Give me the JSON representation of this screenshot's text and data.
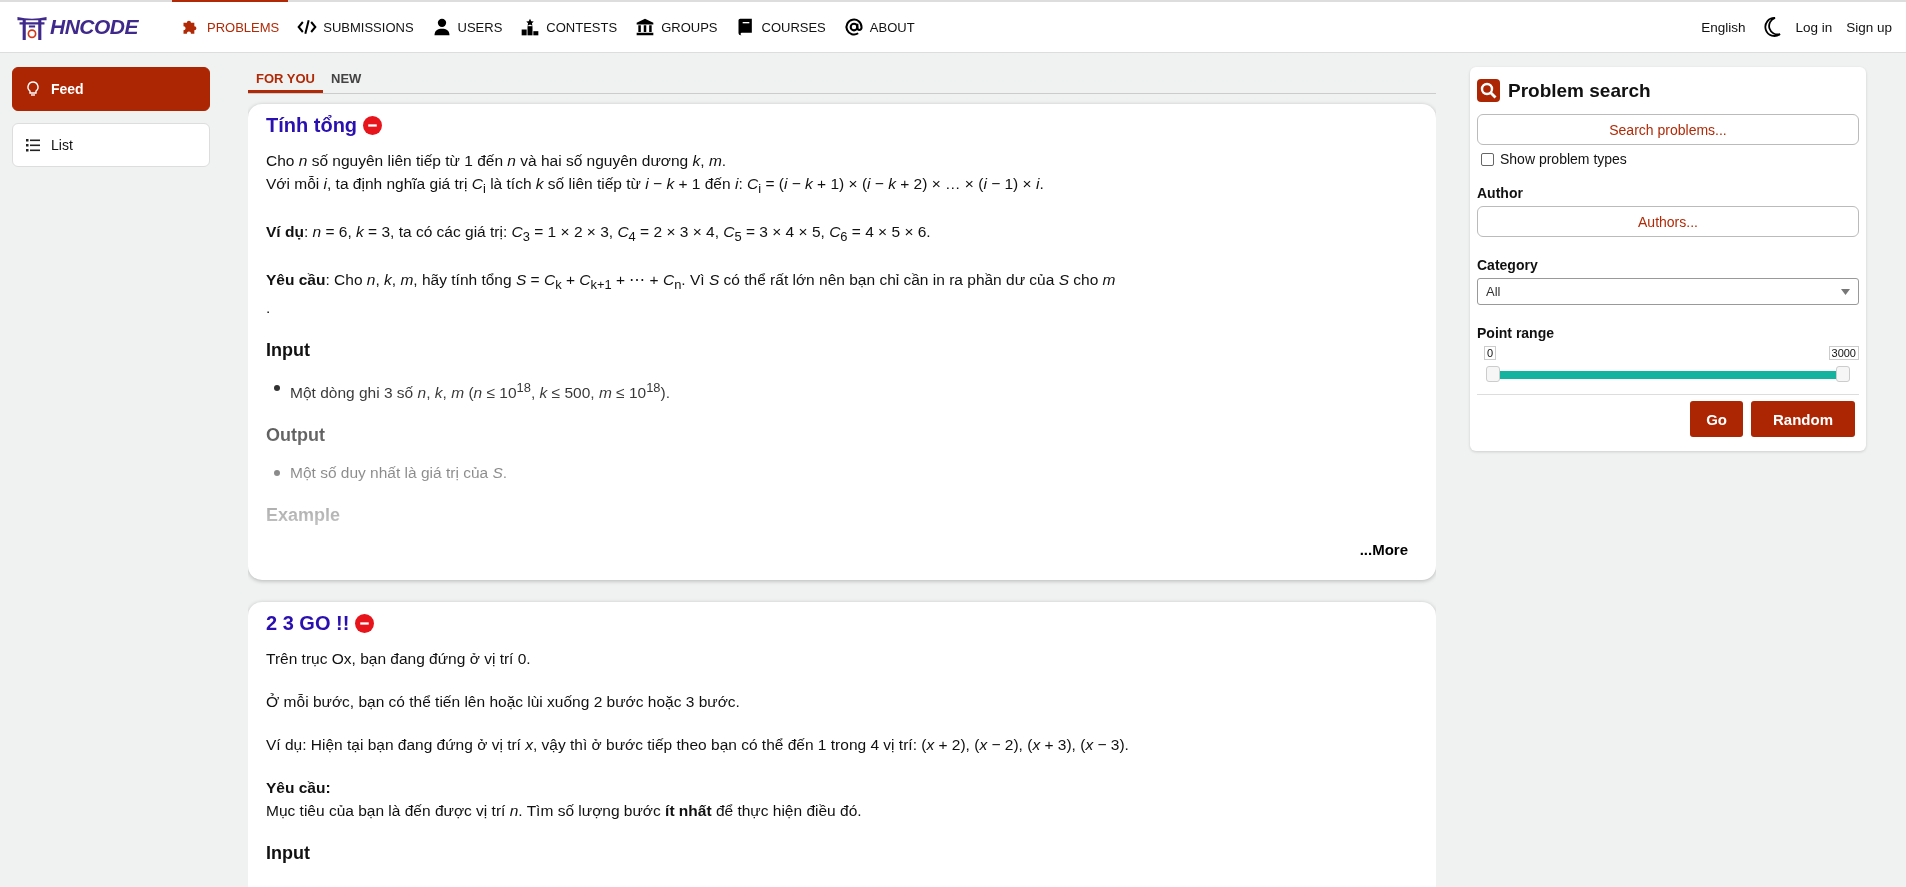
{
  "header": {
    "logo": "HNCODE",
    "nav": [
      {
        "label": "PROBLEMS",
        "selected": true
      },
      {
        "label": "SUBMISSIONS",
        "selected": false
      },
      {
        "label": "USERS",
        "selected": false
      },
      {
        "label": "CONTESTS",
        "selected": false
      },
      {
        "label": "GROUPS",
        "selected": false
      },
      {
        "label": "COURSES",
        "selected": false
      },
      {
        "label": "ABOUT",
        "selected": false
      }
    ],
    "language": "English",
    "links": [
      "Log in",
      "Sign up"
    ]
  },
  "sidebar": {
    "items": [
      {
        "label": "Feed",
        "selected": true
      },
      {
        "label": "List",
        "selected": false
      }
    ]
  },
  "tabs": [
    {
      "label": "FOR YOU",
      "selected": true
    },
    {
      "label": "NEW",
      "selected": false
    }
  ],
  "problems": [
    {
      "title": "Tính tổng",
      "collapsed": true,
      "more": "...More",
      "blocks": [
        {
          "kind": "line",
          "text": "Cho *n* số nguyên liên tiếp từ 1 đến *n* và hai số nguyên dương *k*, *m*."
        },
        {
          "kind": "paragraph",
          "text": "Với mỗi *i*, ta định nghĩa giá trị *C*$_{i}$ là tích *k* số liên tiếp từ *i* − *k* + 1 đến *i*: *C*$_{i}$ = (*i* − *k* + 1) × (*i* − *k* + 2) × … × (*i* − 1) × *i*."
        },
        {
          "kind": "paragraph",
          "text": "**Ví dụ**: *n* = 6, *k* = 3, ta có các giá trị: *C*$_{3}$ = 1 × 2 × 3, *C*$_{4}$ = 2 × 3 × 4, *C*$_{5}$ = 3 × 4 × 5, *C*$_{6}$ = 4 × 5 × 6."
        },
        {
          "kind": "line",
          "text": "**Yêu cầu**: Cho *n*, *k*, *m*, hãy tính tổng *S* = *C*$_{k}$ + *C*$_{k+1}$ + ⋯ + *C*$_{n}$. Vì *S* có thể rất lớn nên bạn chỉ cần in ra phần dư của *S* cho *m*"
        },
        {
          "kind": "paragraph",
          "text": "."
        },
        {
          "kind": "heading",
          "text": "Input"
        },
        {
          "kind": "bullet",
          "text": "Một dòng ghi 3 số *n*, *k*, *m* (*n* ≤ 10$^{18}$, *k* ≤ 500, *m* ≤ 10$^{18}$)."
        },
        {
          "kind": "heading",
          "text": "Output"
        },
        {
          "kind": "bullet",
          "text": "Một số duy nhất là giá trị của *S*."
        },
        {
          "kind": "heading",
          "text": "Example"
        }
      ]
    },
    {
      "title": "2 3 GO !!",
      "collapsed": false,
      "blocks": [
        {
          "kind": "paragraph",
          "text": "Trên trục Ox, bạn đang đứng ở vị trí 0."
        },
        {
          "kind": "paragraph",
          "text": "Ở mỗi bước, bạn có thể tiến lên hoặc lùi xuống 2 bước hoặc 3 bước."
        },
        {
          "kind": "paragraph",
          "text": "Ví dụ: Hiện tại bạn đang đứng ở vị trí *x*, vậy thì ở bước tiếp theo bạn có thể đến 1 trong 4 vị trí: (*x* + 2), (*x* − 2), (*x* + 3), (*x* − 3)."
        },
        {
          "kind": "subheading",
          "text": "Yêu cầu:"
        },
        {
          "kind": "paragraph",
          "text": "Mục tiêu của bạn là đến được vị trí *n*. Tìm số lượng bước **ít nhất** để thực hiện điều đó."
        },
        {
          "kind": "heading",
          "text": "Input"
        }
      ]
    }
  ],
  "search_panel": {
    "title": "Problem search",
    "search": {
      "placeholder": "Search problems..."
    },
    "show_types": {
      "label": "Show problem types",
      "checked": false
    },
    "author": {
      "label": "Author",
      "placeholder": "Authors..."
    },
    "category": {
      "label": "Category",
      "value": "All"
    },
    "point_range": {
      "label": "Point range",
      "min": "0",
      "max": "3000",
      "level": 1
    },
    "buttons": [
      "Go",
      "Random"
    ]
  }
}
